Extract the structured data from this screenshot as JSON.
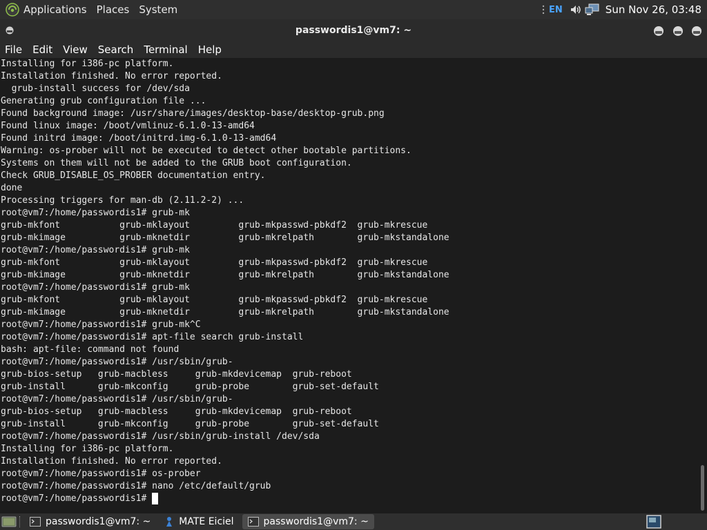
{
  "top_panel": {
    "menus": [
      "Applications",
      "Places",
      "System"
    ],
    "keyboard_layout": "EN",
    "clock": "Sun Nov 26, 03:48"
  },
  "window": {
    "title": "passwordis1@vm7: ~"
  },
  "menubar": {
    "items": [
      "File",
      "Edit",
      "View",
      "Search",
      "Terminal",
      "Help"
    ]
  },
  "terminal": {
    "lines": [
      "Installing for i386-pc platform.",
      "Installation finished. No error reported.",
      "  grub-install success for /dev/sda",
      "Generating grub configuration file ...",
      "Found background image: /usr/share/images/desktop-base/desktop-grub.png",
      "Found linux image: /boot/vmlinuz-6.1.0-13-amd64",
      "Found initrd image: /boot/initrd.img-6.1.0-13-amd64",
      "Warning: os-prober will not be executed to detect other bootable partitions.",
      "Systems on them will not be added to the GRUB boot configuration.",
      "Check GRUB_DISABLE_OS_PROBER documentation entry.",
      "done",
      "Processing triggers for man-db (2.11.2-2) ...",
      "root@vm7:/home/passwordis1# grub-mk",
      "grub-mkfont           grub-mklayout         grub-mkpasswd-pbkdf2  grub-mkrescue",
      "grub-mkimage          grub-mknetdir         grub-mkrelpath        grub-mkstandalone",
      "root@vm7:/home/passwordis1# grub-mk",
      "grub-mkfont           grub-mklayout         grub-mkpasswd-pbkdf2  grub-mkrescue",
      "grub-mkimage          grub-mknetdir         grub-mkrelpath        grub-mkstandalone",
      "root@vm7:/home/passwordis1# grub-mk",
      "grub-mkfont           grub-mklayout         grub-mkpasswd-pbkdf2  grub-mkrescue",
      "grub-mkimage          grub-mknetdir         grub-mkrelpath        grub-mkstandalone",
      "root@vm7:/home/passwordis1# grub-mk^C",
      "root@vm7:/home/passwordis1# apt-file search grub-install",
      "bash: apt-file: command not found",
      "root@vm7:/home/passwordis1# /usr/sbin/grub-",
      "grub-bios-setup   grub-macbless     grub-mkdevicemap  grub-reboot",
      "grub-install      grub-mkconfig     grub-probe        grub-set-default",
      "root@vm7:/home/passwordis1# /usr/sbin/grub-",
      "grub-bios-setup   grub-macbless     grub-mkdevicemap  grub-reboot",
      "grub-install      grub-mkconfig     grub-probe        grub-set-default",
      "root@vm7:/home/passwordis1# /usr/sbin/grub-install /dev/sda",
      "Installing for i386-pc platform.",
      "Installation finished. No error reported.",
      "root@vm7:/home/passwordis1# os-prober",
      "root@vm7:/home/passwordis1# nano /etc/default/grub",
      "root@vm7:/home/passwordis1# "
    ]
  },
  "taskbar": {
    "tasks": [
      {
        "label": "passwordis1@vm7: ~",
        "icon": "terminal-icon",
        "active": false
      },
      {
        "label": "MATE Eiciel",
        "icon": "eiciel-icon",
        "active": false
      },
      {
        "label": "passwordis1@vm7: ~",
        "icon": "terminal-icon",
        "active": true
      }
    ]
  },
  "colors": {
    "panel_bg": "#2f2f2f",
    "terminal_bg": "#1c1c1c",
    "terminal_fg": "#e6e6e6",
    "keyboard_accent": "#4aa3ff"
  }
}
